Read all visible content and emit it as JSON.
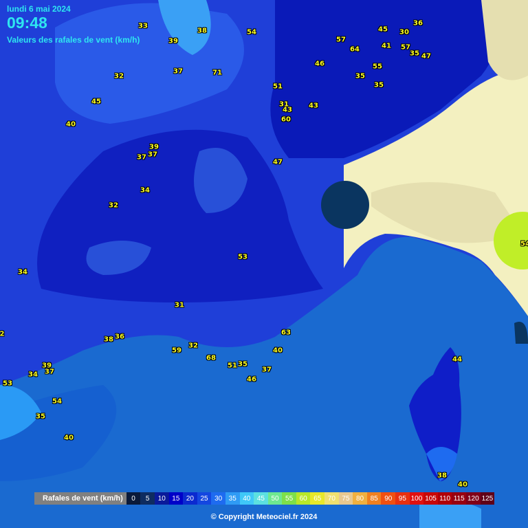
{
  "header": {
    "date": "lundi 6 mai 2024",
    "time": "09:48",
    "subtitle": "Valeurs des rafales de vent (km/h)"
  },
  "stations": [
    "33",
    "38",
    "39",
    "54",
    "45",
    "30",
    "36",
    "57",
    "64",
    "41",
    "57",
    "35",
    "47",
    "37",
    "71",
    "46",
    "55",
    "32",
    "35",
    "45",
    "51",
    "35",
    "31",
    "43",
    "43",
    "40",
    "60",
    "39",
    "37",
    "37",
    "47",
    "34",
    "32",
    "53",
    "34",
    "31",
    "63",
    "38",
    "36",
    "59",
    "32",
    "68",
    "51",
    "35",
    "40",
    "37",
    "46",
    "39",
    "37",
    "34",
    "53",
    "2",
    "54",
    "35",
    "40",
    "44",
    "38",
    "40",
    "54"
  ],
  "legend": {
    "title": "Rafales de vent (km/h)",
    "scale": [
      {
        "label": "0",
        "color": "#0a1a3a"
      },
      {
        "label": "5",
        "color": "#0e2c60"
      },
      {
        "label": "10",
        "color": "#0a1a9a"
      },
      {
        "label": "15",
        "color": "#0000c8"
      },
      {
        "label": "20",
        "color": "#0b2ad0"
      },
      {
        "label": "25",
        "color": "#1447e0"
      },
      {
        "label": "30",
        "color": "#1e6bf0"
      },
      {
        "label": "35",
        "color": "#2f9bf5"
      },
      {
        "label": "40",
        "color": "#3fc8f8"
      },
      {
        "label": "45",
        "color": "#5ce0e0"
      },
      {
        "label": "50",
        "color": "#6ee890"
      },
      {
        "label": "55",
        "color": "#7ee04a"
      },
      {
        "label": "60",
        "color": "#b8e82a"
      },
      {
        "label": "65",
        "color": "#e8e82a"
      },
      {
        "label": "70",
        "color": "#f0e070"
      },
      {
        "label": "75",
        "color": "#e8c890"
      },
      {
        "label": "80",
        "color": "#f0b040"
      },
      {
        "label": "85",
        "color": "#f08020"
      },
      {
        "label": "90",
        "color": "#f05010"
      },
      {
        "label": "95",
        "color": "#e83010"
      },
      {
        "label": "100",
        "color": "#e01010"
      },
      {
        "label": "105",
        "color": "#c80808"
      },
      {
        "label": "110",
        "color": "#b00008"
      },
      {
        "label": "115",
        "color": "#980010"
      },
      {
        "label": "120",
        "color": "#800018"
      },
      {
        "label": "125",
        "color": "#600018"
      }
    ]
  },
  "copyright": "© Copyright Meteociel.fr 2024"
}
